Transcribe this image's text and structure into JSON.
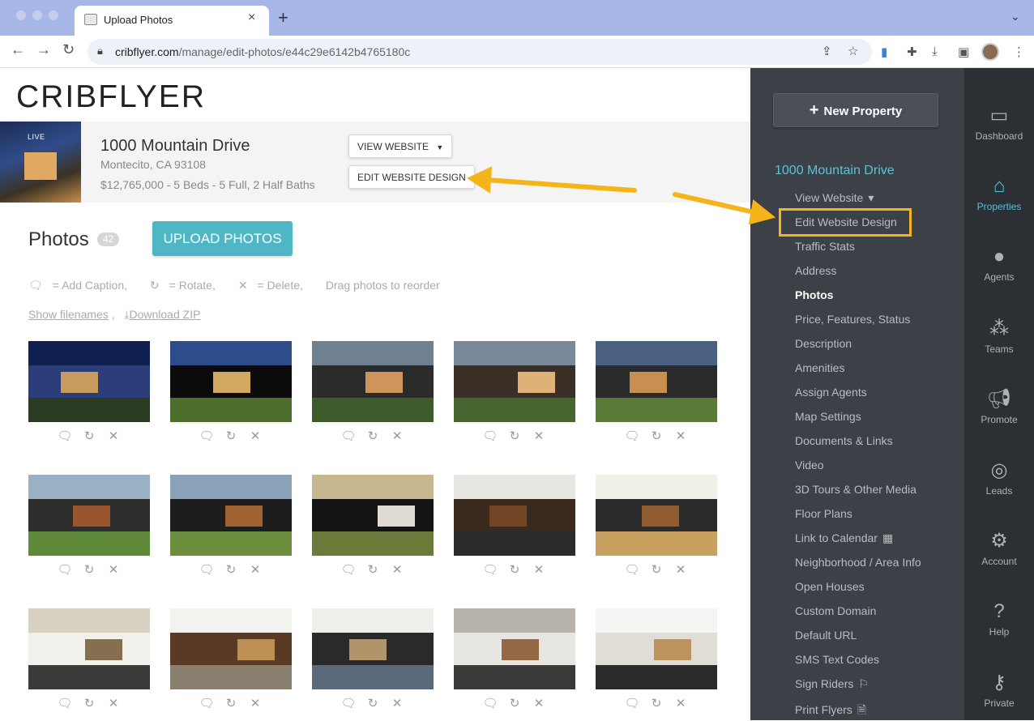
{
  "browser": {
    "tab_title": "Upload Photos",
    "url_host": "cribflyer.com",
    "url_path": "/manage/edit-photos/e44c29e6142b4765180c"
  },
  "logo": "CRIBFLYER",
  "property": {
    "live_badge": "LIVE",
    "name": "1000 Mountain Drive",
    "city": "Montecito, CA 93108",
    "details": "$12,765,000 - 5 Beds - 5 Full, 2 Half Baths",
    "view_website_label": "VIEW WEBSITE",
    "edit_design_label": "EDIT WEBSITE DESIGN"
  },
  "photos": {
    "title": "Photos",
    "count": "42",
    "upload_label": "UPLOAD PHOTOS",
    "legend": {
      "caption": "= Add Caption,",
      "rotate": "= Rotate,",
      "delete": "= Delete,",
      "drag": "Drag photos to reorder"
    },
    "show_filenames": "Show filenames",
    "download_zip": "Download ZIP"
  },
  "sidebar": {
    "new_property_label": "New Property",
    "property_title": "1000 Mountain Drive",
    "items": [
      {
        "label": "View Website"
      },
      {
        "label": "Edit Website Design"
      },
      {
        "label": "Traffic Stats"
      },
      {
        "label": "Address"
      },
      {
        "label": "Photos"
      },
      {
        "label": "Price, Features, Status"
      },
      {
        "label": "Description"
      },
      {
        "label": "Amenities"
      },
      {
        "label": "Assign Agents"
      },
      {
        "label": "Map Settings"
      },
      {
        "label": "Documents & Links"
      },
      {
        "label": "Video"
      },
      {
        "label": "3D Tours & Other Media"
      },
      {
        "label": "Floor Plans"
      },
      {
        "label": "Link to Calendar"
      },
      {
        "label": "Neighborhood / Area Info"
      },
      {
        "label": "Open Houses"
      },
      {
        "label": "Custom Domain"
      },
      {
        "label": "Default URL"
      },
      {
        "label": "SMS Text Codes"
      },
      {
        "label": "Sign Riders"
      },
      {
        "label": "Print Flyers"
      }
    ]
  },
  "rail": {
    "items": [
      {
        "label": "Dashboard",
        "icon": "dashboard-icon"
      },
      {
        "label": "Properties",
        "icon": "home-icon"
      },
      {
        "label": "Agents",
        "icon": "person-icon"
      },
      {
        "label": "Teams",
        "icon": "group-icon"
      },
      {
        "label": "Promote",
        "icon": "megaphone-icon"
      },
      {
        "label": "Leads",
        "icon": "target-icon"
      },
      {
        "label": "Account",
        "icon": "gear-icon"
      },
      {
        "label": "Help",
        "icon": "help-icon"
      },
      {
        "label": "Private",
        "icon": "key-icon"
      }
    ]
  },
  "colors": {
    "accent_teal": "#4fb6c6",
    "sidebar_bg": "#3c4147",
    "rail_bg": "#2c3034",
    "annotation_yellow": "#f4b41a"
  }
}
